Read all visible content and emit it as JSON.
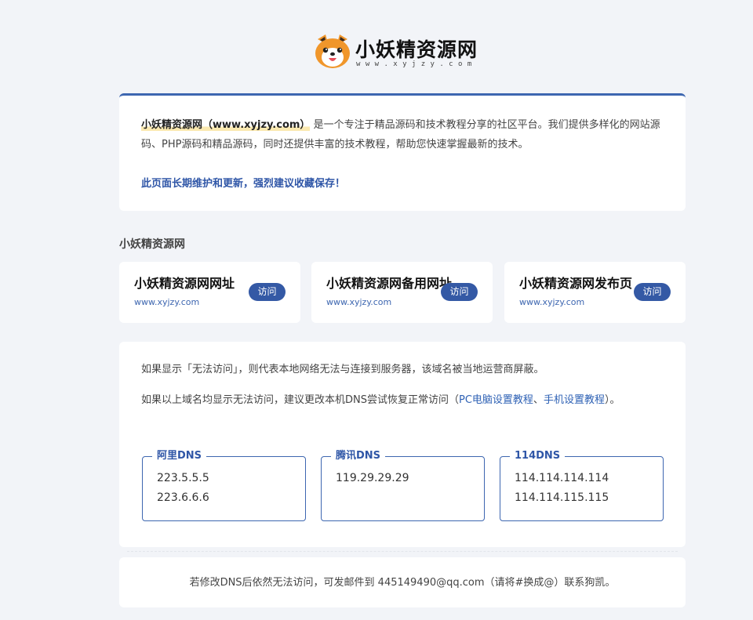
{
  "header": {
    "site_name": "小妖精资源网",
    "site_url": "www.xyjzy.com"
  },
  "intro": {
    "highlight": "小妖精资源网（www.xyjzy.com）",
    "description": "是一个专注于精品源码和技术教程分享的社区平台。我们提供多样化的网站源码、PHP源码和精品源码，同时还提供丰富的技术教程，帮助您快速掌握最新的技术。",
    "note": "此页面长期维护和更新，强烈建议收藏保存！"
  },
  "section_title": "小妖精资源网",
  "sites": [
    {
      "title": "小妖精资源网网址",
      "url": "www.xyjzy.com",
      "button": "访问"
    },
    {
      "title": "小妖精资源网备用网址",
      "url": "www.xyjzy.com",
      "button": "访问"
    },
    {
      "title": "小妖精资源网发布页",
      "url": "www.xyjzy.com",
      "button": "访问"
    }
  ],
  "dns_info": {
    "line1": "如果显示「无法访问」，则代表本地网络无法与连接到服务器，该域名被当地运营商屏蔽。",
    "line2_prefix": "如果以上域名均显示无法访问，建议更改本机DNS尝试恢复正常访问（",
    "pc_link": "PC电脑设置教程",
    "separator": "、",
    "mobile_link": "手机设置教程",
    "line2_suffix": "）。"
  },
  "dns_servers": [
    {
      "name": "阿里DNS",
      "ips": [
        "223.5.5.5",
        "223.6.6.6"
      ]
    },
    {
      "name": "腾讯DNS",
      "ips": [
        "119.29.29.29"
      ]
    },
    {
      "name": "114DNS",
      "ips": [
        "114.114.114.114",
        "114.114.115.115"
      ]
    }
  ],
  "footer": {
    "text": "若修改DNS后依然无法访问，可发邮件到 445149490@qq.com（请将#换成@）联系狗凯。"
  },
  "colors": {
    "accent": "#3d66b0",
    "button": "#3459a5",
    "link": "#2f62b5",
    "background": "#f2f4f8"
  }
}
